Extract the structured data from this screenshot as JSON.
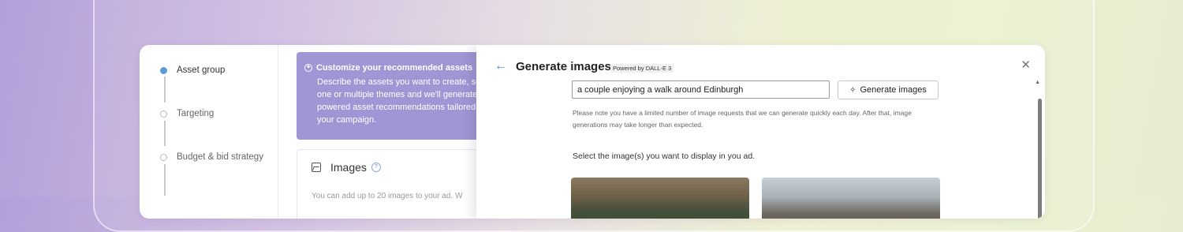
{
  "stepper": {
    "steps": [
      {
        "label": "Asset group",
        "active": true
      },
      {
        "label": "Targeting",
        "active": false
      },
      {
        "label": "Budget & bid strategy",
        "active": false
      }
    ]
  },
  "banner": {
    "title": "Customize your recommended assets",
    "body": "Describe the assets you want to create, sel one or multiple themes and we'll generate powered asset recommendations tailored your campaign."
  },
  "images_card": {
    "title": "Images",
    "description": "You can add up to 20 images to your ad. W"
  },
  "panel": {
    "title": "Generate images",
    "powered_by": "Powered by DALL-E 3",
    "prompt_value": "a couple enjoying a walk around Edinburgh",
    "generate_label": "Generate images",
    "note": "Please note you have a limited number of image requests that we can generate quickly each day. After that, image generations may take longer than expected.",
    "select_text": "Select the image(s) you want to display in you ad."
  },
  "colors": {
    "accent": "#5b9bd5",
    "banner": "#a096d6"
  }
}
